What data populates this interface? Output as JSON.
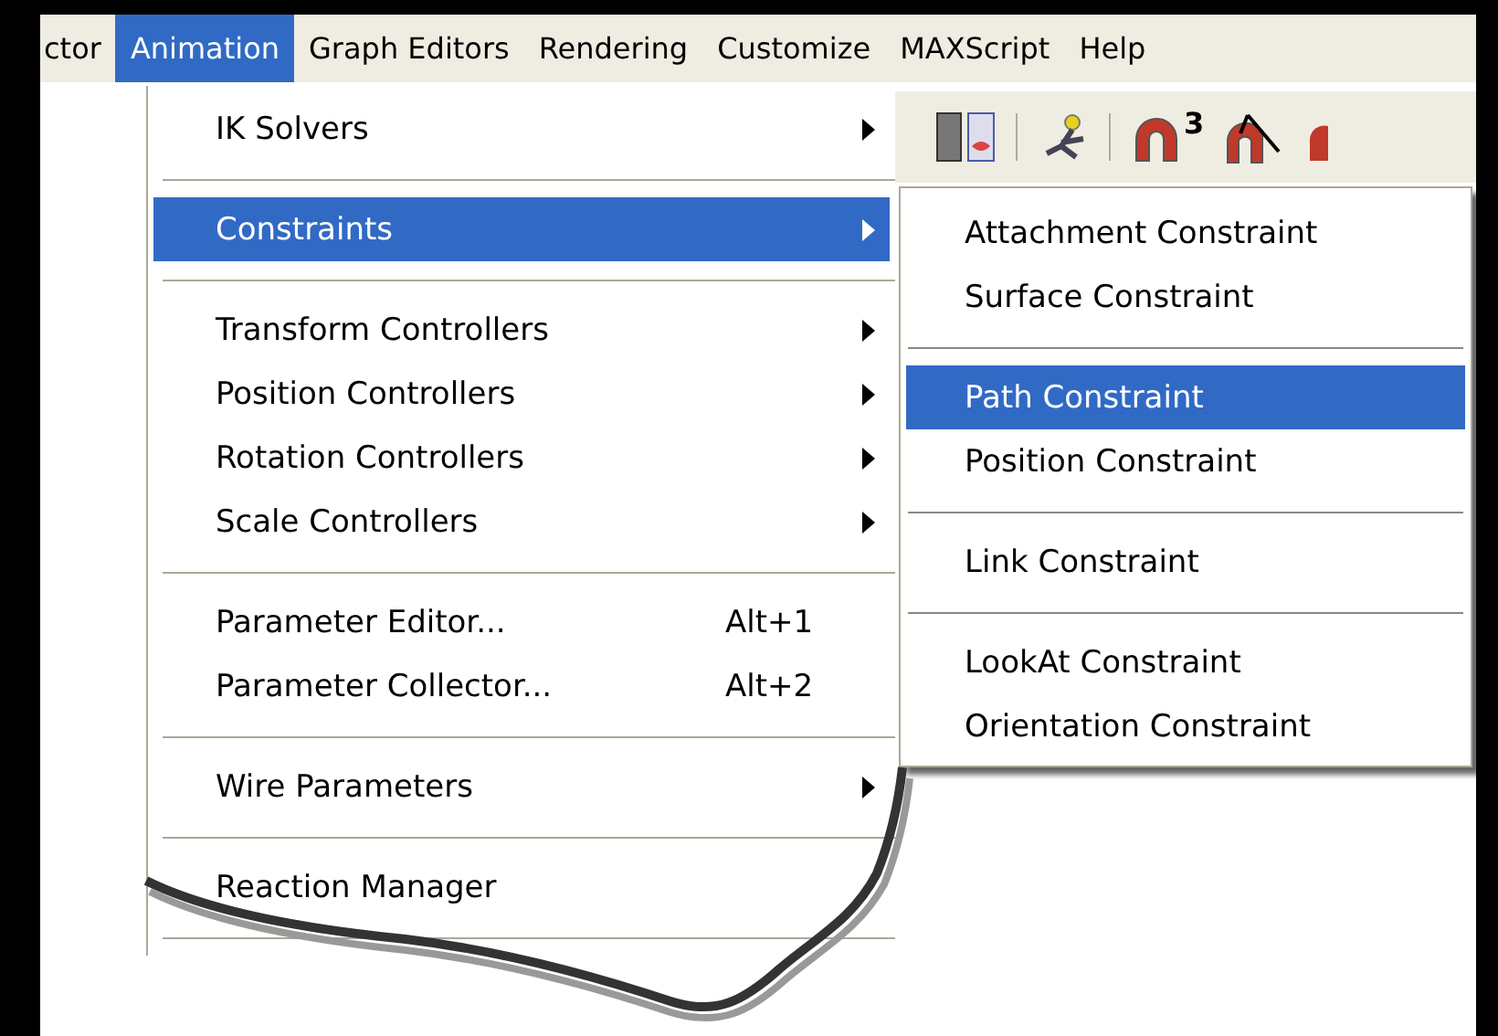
{
  "menubar": [
    {
      "label": "ctor",
      "selected": false
    },
    {
      "label": "Animation",
      "selected": true
    },
    {
      "label": "Graph Editors",
      "selected": false
    },
    {
      "label": "Rendering",
      "selected": false
    },
    {
      "label": "Customize",
      "selected": false
    },
    {
      "label": "MAXScript",
      "selected": false
    },
    {
      "label": "Help",
      "selected": false
    }
  ],
  "toolbar": [
    {
      "kind": "panels"
    },
    {
      "kind": "figure"
    },
    {
      "kind": "snap",
      "label": "3"
    },
    {
      "kind": "angle"
    },
    {
      "kind": "partial"
    }
  ],
  "menu": [
    {
      "kind": "submenu",
      "label": "IK Solvers",
      "selected": false
    },
    {
      "kind": "separator"
    },
    {
      "kind": "submenu",
      "label": "Constraints",
      "selected": true
    },
    {
      "kind": "separator"
    },
    {
      "kind": "submenu",
      "label": "Transform Controllers",
      "selected": false
    },
    {
      "kind": "submenu",
      "label": "Position Controllers",
      "selected": false
    },
    {
      "kind": "submenu",
      "label": "Rotation Controllers",
      "selected": false
    },
    {
      "kind": "submenu",
      "label": "Scale Controllers",
      "selected": false
    },
    {
      "kind": "separator"
    },
    {
      "kind": "command",
      "label": "Parameter Editor...",
      "shortcut": "Alt+1",
      "selected": false
    },
    {
      "kind": "command",
      "label": "Parameter Collector...",
      "shortcut": "Alt+2",
      "selected": false
    },
    {
      "kind": "separator"
    },
    {
      "kind": "submenu",
      "label": "Wire Parameters",
      "selected": false
    },
    {
      "kind": "separator"
    },
    {
      "kind": "command",
      "label": "Reaction Manager",
      "selected": false
    },
    {
      "kind": "separator"
    }
  ],
  "submenu": [
    {
      "kind": "command",
      "label": "Attachment Constraint",
      "selected": false
    },
    {
      "kind": "command",
      "label": "Surface Constraint",
      "selected": false
    },
    {
      "kind": "separator"
    },
    {
      "kind": "command",
      "label": "Path Constraint",
      "selected": true
    },
    {
      "kind": "command",
      "label": "Position Constraint",
      "selected": false
    },
    {
      "kind": "separator"
    },
    {
      "kind": "command",
      "label": "Link Constraint",
      "selected": false
    },
    {
      "kind": "separator"
    },
    {
      "kind": "command",
      "label": "LookAt Constraint",
      "selected": false
    },
    {
      "kind": "command",
      "label": "Orientation Constraint",
      "selected": false
    }
  ]
}
